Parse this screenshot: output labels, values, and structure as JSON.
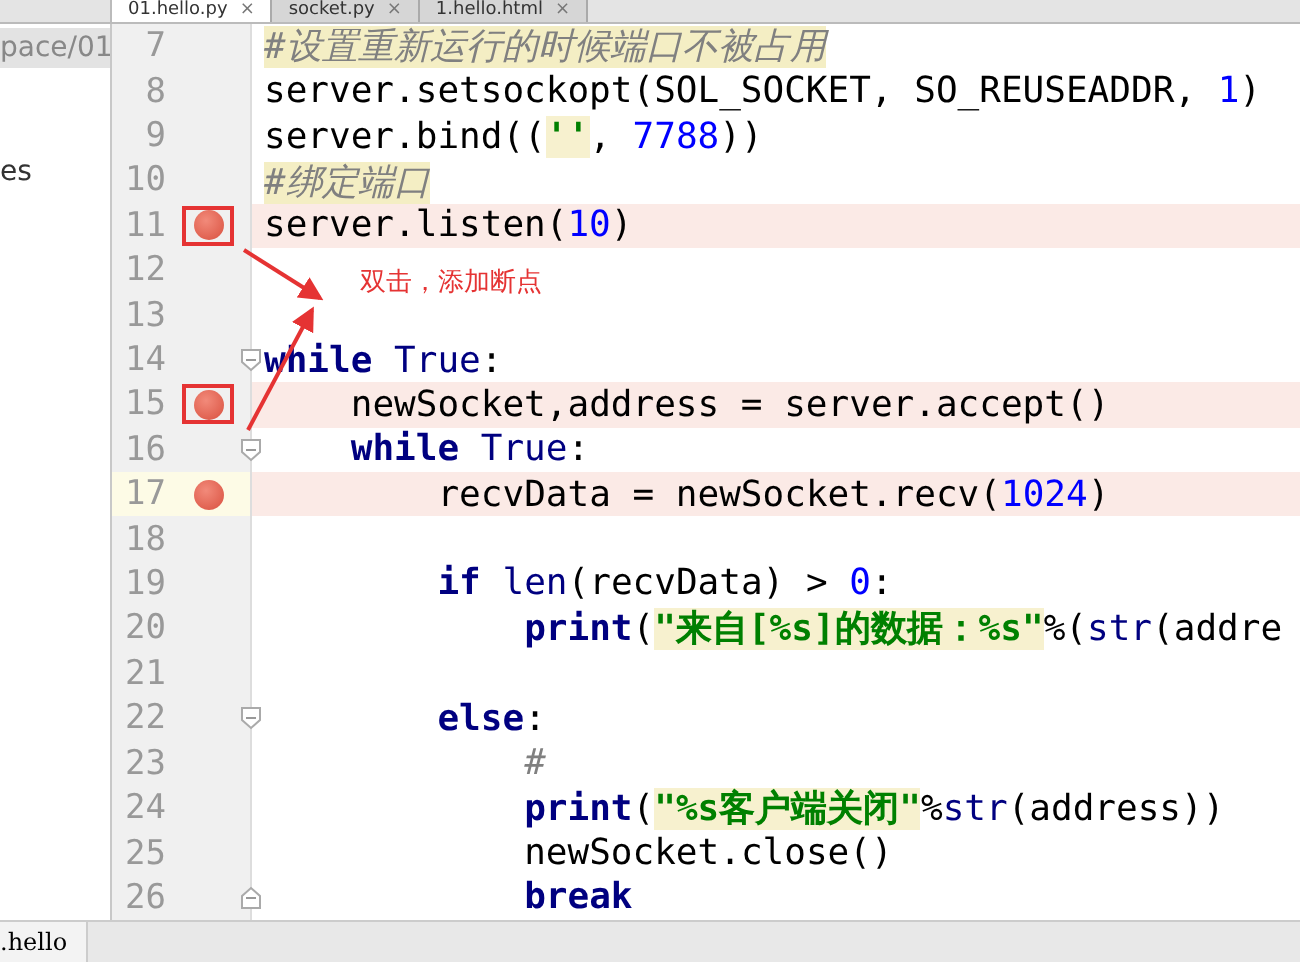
{
  "tabs": [
    {
      "label": "01.hello.py",
      "selected": true,
      "close": "×"
    },
    {
      "label": "socket.py",
      "selected": false,
      "close": "×"
    },
    {
      "label": "1.hello.html",
      "selected": false,
      "close": "×"
    }
  ],
  "project_panel": {
    "path": "pace/01",
    "item": "es",
    "bottom_tab": ".hello"
  },
  "lines": [
    {
      "num": "7",
      "breakpoint": false,
      "boxed": false,
      "caret": false,
      "tokens": [
        {
          "kind": "comment",
          "text": "#设置重新运行的时候端口不被占用"
        }
      ]
    },
    {
      "num": "8",
      "breakpoint": false,
      "boxed": false,
      "caret": false,
      "tokens": [
        {
          "kind": "plain",
          "text": "server.setsockopt(SOL_SOCKET, SO_REUSEADDR, "
        },
        {
          "kind": "num",
          "text": "1"
        },
        {
          "kind": "plain",
          "text": ")"
        }
      ]
    },
    {
      "num": "9",
      "breakpoint": false,
      "boxed": false,
      "caret": false,
      "tokens": [
        {
          "kind": "plain",
          "text": "server.bind(("
        },
        {
          "kind": "str",
          "text": "''"
        },
        {
          "kind": "plain",
          "text": ", "
        },
        {
          "kind": "num",
          "text": "7788"
        },
        {
          "kind": "plain",
          "text": "))"
        }
      ]
    },
    {
      "num": "10",
      "breakpoint": false,
      "boxed": false,
      "caret": false,
      "tokens": [
        {
          "kind": "comment",
          "text": "#绑定端口"
        }
      ]
    },
    {
      "num": "11",
      "breakpoint": true,
      "boxed": true,
      "caret": false,
      "tokens": [
        {
          "kind": "plain",
          "text": "server.listen("
        },
        {
          "kind": "num",
          "text": "10"
        },
        {
          "kind": "plain",
          "text": ")"
        }
      ]
    },
    {
      "num": "12",
      "breakpoint": false,
      "boxed": false,
      "caret": false
    },
    {
      "num": "13",
      "breakpoint": false,
      "boxed": false,
      "caret": false
    },
    {
      "num": "14",
      "breakpoint": false,
      "boxed": false,
      "caret": false,
      "fold": {
        "kind": "start"
      },
      "tokens": [
        {
          "kind": "keyword",
          "text": "while"
        },
        {
          "kind": "builtin",
          "text": " True"
        },
        {
          "kind": "plain",
          "text": ":"
        }
      ],
      "children": [
        {
          "num": "15",
          "breakpoint": true,
          "boxed": true,
          "caret": false,
          "tokens": [
            {
              "kind": "plain",
              "text": "newSocket,address = server.accept()"
            }
          ]
        },
        {
          "num": "16",
          "breakpoint": false,
          "boxed": false,
          "caret": false,
          "fold": {
            "kind": "start"
          },
          "tokens": [
            {
              "kind": "keyword",
              "text": "while"
            },
            {
              "kind": "builtin",
              "text": " True"
            },
            {
              "kind": "plain",
              "text": ":"
            }
          ],
          "children": [
            {
              "num": "17",
              "breakpoint": true,
              "boxed": false,
              "caret": true,
              "tokens": [
                {
                  "kind": "plain",
                  "text": "recvData = newSocket.recv("
                },
                {
                  "kind": "num",
                  "text": "1024"
                },
                {
                  "kind": "plain",
                  "text": ")"
                }
              ]
            },
            {
              "num": "18",
              "breakpoint": false,
              "boxed": false,
              "caret": false
            },
            {
              "num": "19",
              "breakpoint": false,
              "boxed": false,
              "caret": false,
              "tokens": [
                {
                  "kind": "keyword",
                  "text": "if"
                },
                {
                  "kind": "builtin",
                  "text": " len"
                },
                {
                  "kind": "plain",
                  "text": "(recvData) > "
                },
                {
                  "kind": "num",
                  "text": "0"
                },
                {
                  "kind": "plain",
                  "text": ":"
                }
              ],
              "children": [
                {
                  "num": "20",
                  "breakpoint": false,
                  "boxed": false,
                  "caret": false,
                  "tokens": [
                    {
                      "kind": "keyword",
                      "text": "print"
                    },
                    {
                      "kind": "plain",
                      "text": "("
                    },
                    {
                      "kind": "str",
                      "text": "\"来自[%s]的数据：%s\""
                    },
                    {
                      "kind": "plain",
                      "text": "%("
                    },
                    {
                      "kind": "builtin",
                      "text": "str"
                    },
                    {
                      "kind": "plain",
                      "text": "(addre"
                    }
                  ]
                },
                {
                  "num": "21",
                  "breakpoint": false,
                  "boxed": false,
                  "caret": false
                }
              ]
            },
            {
              "num": "22",
              "breakpoint": false,
              "boxed": false,
              "caret": false,
              "fold": {
                "kind": "start"
              },
              "tokens": [
                {
                  "kind": "keyword",
                  "text": "else"
                },
                {
                  "kind": "plain",
                  "text": ":"
                }
              ],
              "children": [
                {
                  "num": "23",
                  "breakpoint": false,
                  "boxed": false,
                  "caret": false,
                  "tokens": [
                    {
                      "kind": "hash",
                      "text": "#"
                    }
                  ]
                },
                {
                  "num": "24",
                  "breakpoint": false,
                  "boxed": false,
                  "caret": false,
                  "tokens": [
                    {
                      "kind": "keyword",
                      "text": "print"
                    },
                    {
                      "kind": "plain",
                      "text": "("
                    },
                    {
                      "kind": "str",
                      "text": "\"%s客户端关闭\""
                    },
                    {
                      "kind": "plain",
                      "text": "%"
                    },
                    {
                      "kind": "builtin",
                      "text": "str"
                    },
                    {
                      "kind": "plain",
                      "text": "(address))"
                    }
                  ]
                },
                {
                  "num": "25",
                  "breakpoint": false,
                  "boxed": false,
                  "caret": false,
                  "tokens": [
                    {
                      "kind": "plain",
                      "text": "newSocket.close()"
                    }
                  ]
                },
                {
                  "num": "26",
                  "breakpoint": false,
                  "boxed": false,
                  "caret": false,
                  "fold": {
                    "kind": "end"
                  },
                  "tokens": [
                    {
                      "kind": "keyword",
                      "text": "break"
                    }
                  ]
                }
              ]
            }
          ]
        }
      ]
    }
  ],
  "annotation": {
    "text": "双击，添加断点"
  }
}
